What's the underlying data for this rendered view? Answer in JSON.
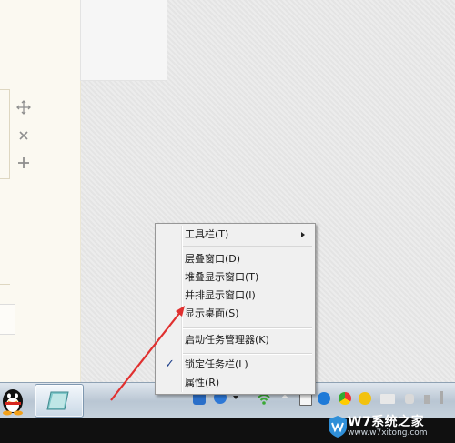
{
  "context_menu": {
    "items": [
      {
        "label": "工具栏(T)",
        "has_submenu": true
      },
      {
        "label": "层叠窗口(D)"
      },
      {
        "label": "堆叠显示窗口(T)"
      },
      {
        "label": "并排显示窗口(I)"
      },
      {
        "label": "显示桌面(S)"
      },
      {
        "label": "启动任务管理器(K)"
      },
      {
        "label": "锁定任务栏(L)",
        "checked": true
      },
      {
        "label": "属性(R)"
      }
    ]
  },
  "left_panel": {
    "icons": [
      "move-icon",
      "close-icon",
      "plus-icon"
    ]
  },
  "taskbar": {
    "tray_icons": [
      "language-icon",
      "help-icon",
      "dropdown-icon",
      "network-icon",
      "expand-tray-icon",
      "windows-icon",
      "security-icon",
      "chrome-icon",
      "app-icon",
      "folder-icon",
      "volume-icon"
    ]
  },
  "watermark": {
    "title": "W7系统之家",
    "url": "www.w7xitong.com"
  },
  "colors": {
    "menu_bg": "#f0f0f0",
    "arrow": "#e0302f",
    "taskbar": "#c7d3de"
  }
}
